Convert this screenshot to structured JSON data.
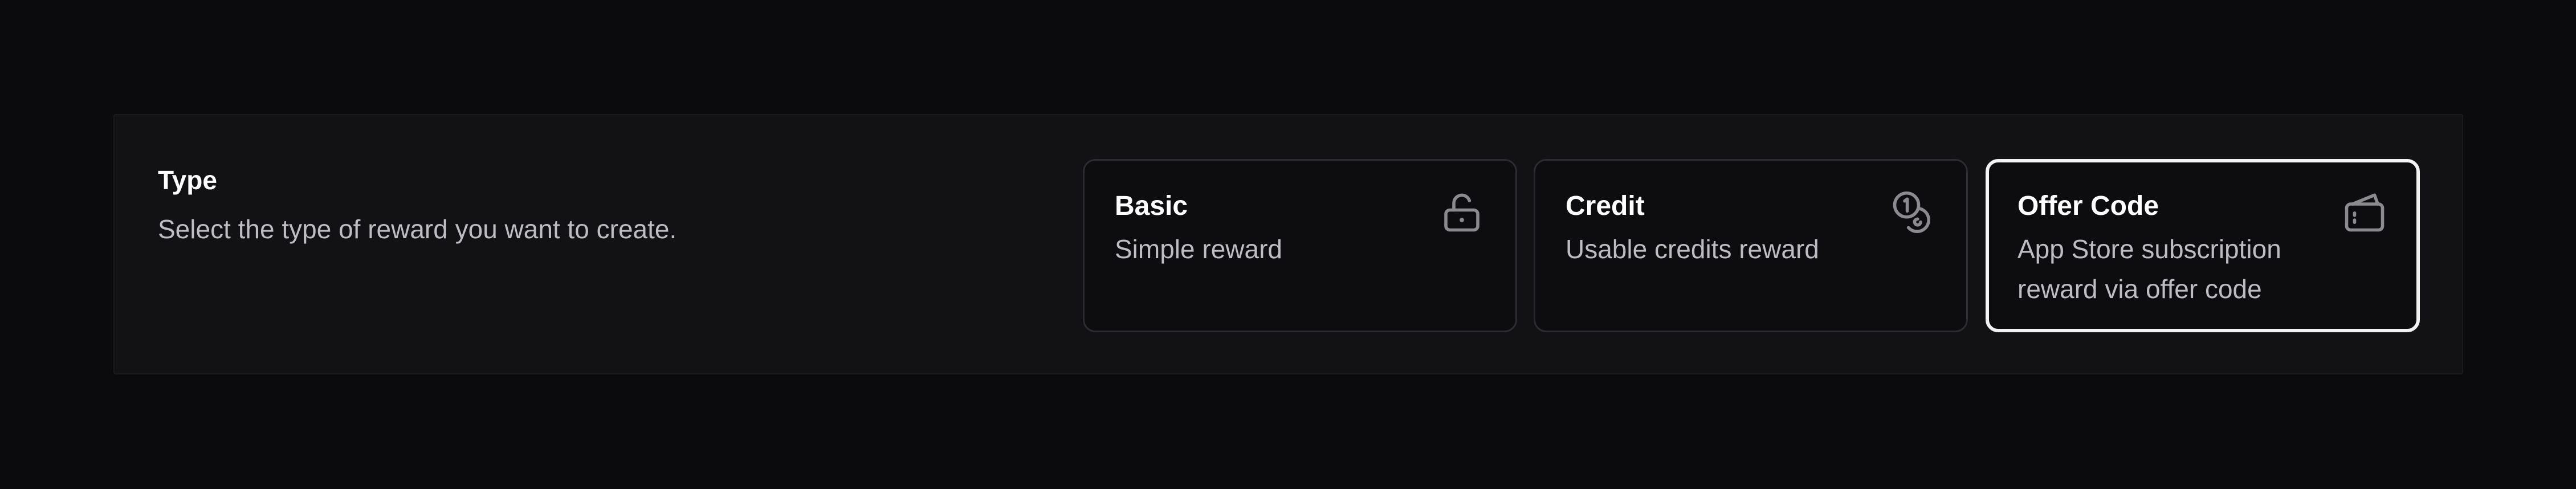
{
  "section": {
    "title": "Type",
    "subtitle": "Select the type of reward you want to create."
  },
  "options": [
    {
      "title": "Basic",
      "description": "Simple reward",
      "icon": "unlock-icon",
      "selected": false
    },
    {
      "title": "Credit",
      "description": "Usable credits reward",
      "icon": "coins-icon",
      "selected": false
    },
    {
      "title": "Offer Code",
      "description": "App Store subscription reward via offer code",
      "icon": "ticket-card-icon",
      "selected": true
    }
  ],
  "colors": {
    "background": "#0b0b0d",
    "panel": "#121214",
    "card": "#0d0d0f",
    "border": "#2d2d31",
    "selected_border": "#f2f2f2",
    "text_primary": "#ffffff",
    "text_secondary": "#bdbdc2",
    "icon": "#8a8a8f"
  }
}
